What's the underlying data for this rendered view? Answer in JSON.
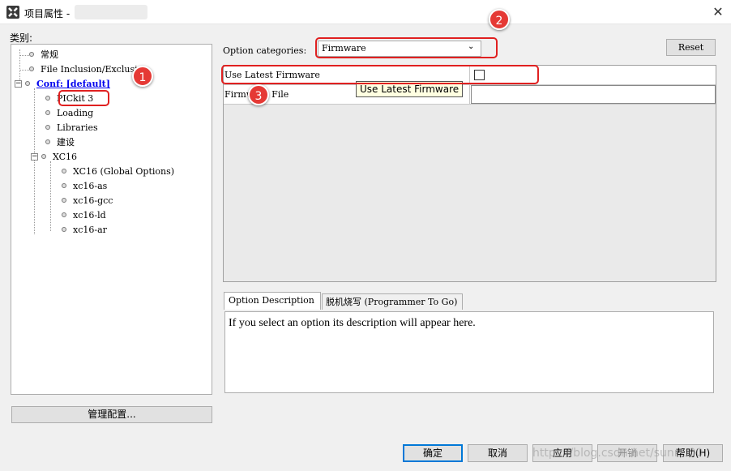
{
  "window": {
    "title": "项目属性 -",
    "close_label": "✕"
  },
  "categories": {
    "label": "类别:",
    "items": [
      {
        "label": "常规"
      },
      {
        "label": "File Inclusion/Exclusion"
      },
      {
        "label": "Conf: [default]"
      },
      {
        "label": "PICkit 3"
      },
      {
        "label": "Loading"
      },
      {
        "label": "Libraries"
      },
      {
        "label": "建设"
      },
      {
        "label": "XC16"
      },
      {
        "label": "XC16 (Global Options)"
      },
      {
        "label": "xc16-as"
      },
      {
        "label": "xc16-gcc"
      },
      {
        "label": "xc16-ld"
      },
      {
        "label": "xc16-ar"
      }
    ],
    "manage_button": "管理配置..."
  },
  "options": {
    "category_label": "Option categories:",
    "category_value": "Firmware",
    "reset_label": "Reset",
    "rows": [
      {
        "name": "Use Latest Firmware",
        "checked": false
      },
      {
        "name": "Firmware File",
        "value": ""
      }
    ],
    "tooltip": "Use Latest Firmware"
  },
  "tabs": [
    {
      "label": "Option Description"
    },
    {
      "label": "脱机烧写 (Programmer To Go)"
    }
  ],
  "description": "If you select an option its description will appear here.",
  "buttons": {
    "ok": "确定",
    "cancel": "取消",
    "apply": "应用",
    "undo": "开销",
    "help": "帮助(H)"
  },
  "annotations": [
    "1",
    "2",
    "3"
  ],
  "watermark": "https://blog.csdn.net/sunr...00",
  "colors": {
    "annotation": "#e53935",
    "link": "#0000ee",
    "focus": "#0078d7",
    "tooltip_bg": "#ffffe1"
  }
}
